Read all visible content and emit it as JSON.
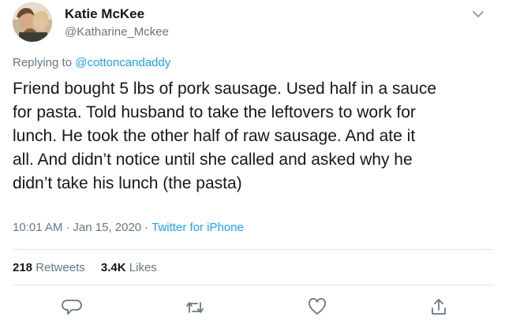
{
  "tweet": {
    "author_name": "Katie McKee",
    "author_handle": "@Katharine_Mckee",
    "reply_prefix": "Replying to",
    "reply_to": "@cottoncandaddy",
    "text": "Friend bought 5 lbs of pork sausage. Used half in a sauce\nfor pasta. Told husband to take the leftovers to work for\nlunch. He took the other half of raw sausage. And ate it\nall. And didn’t notice until she called and asked why he\ndidn’t take his lunch (the pasta)",
    "time": "10:01 AM",
    "date": "Jan 15, 2020",
    "separator": "·",
    "source": "Twitter for iPhone",
    "retweets_count": "218",
    "retweets_label": "Retweets",
    "likes_count": "3.4K",
    "likes_label": "Likes"
  },
  "icons": {
    "caret": "chevron-down-icon",
    "reply": "reply-icon",
    "retweet": "retweet-icon",
    "like": "heart-icon",
    "share": "share-icon"
  },
  "colors": {
    "accent": "#1da1f2",
    "secondary_text": "#657786",
    "primary_text": "#14171a",
    "divider": "#e1e8ed"
  }
}
